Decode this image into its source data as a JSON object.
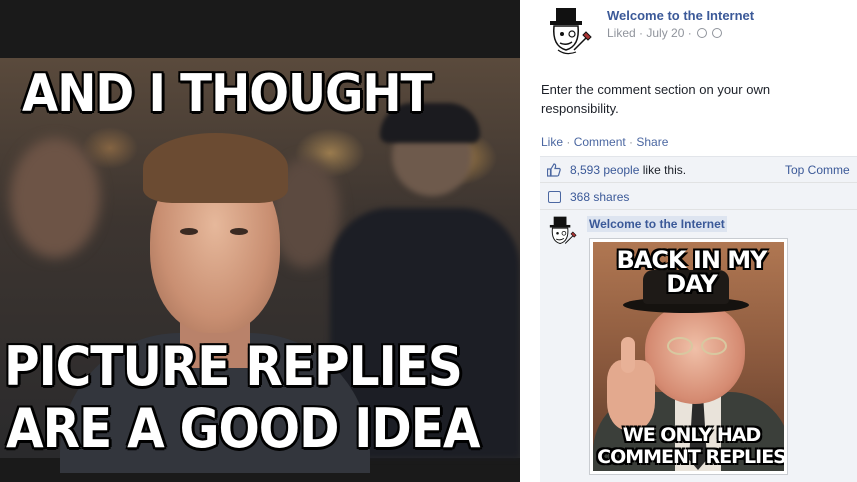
{
  "meme": {
    "caption_top": "AND I THOUGHT",
    "caption_bottom_line1": "PICTURE REPLIES",
    "caption_bottom_line2": "ARE A GOOD IDEA"
  },
  "post": {
    "page_name": "Welcome to the Internet",
    "liked_label": "Liked",
    "date": "July 20",
    "text": "Enter the comment section on your own responsibility.",
    "actions": {
      "like": "Like",
      "comment": "Comment",
      "share": "Share"
    },
    "likes_count": "8,593 people",
    "likes_suffix": " like this.",
    "top_comments_label": "Top Comme",
    "shares_label": "368 shares"
  },
  "comment": {
    "author": "Welcome to the Internet",
    "image_caption_top": "BACK IN MY DAY",
    "image_caption_bottom_line1": "WE ONLY HAD",
    "image_caption_bottom_line2": "COMMENT REPLIES"
  },
  "icons": {
    "avatar": "gentleman-top-hat-icon",
    "like": "thumbs-up-icon",
    "share": "share-icon",
    "privacy": "globe-icon",
    "edit": "clock-icon"
  },
  "colors": {
    "link_blue": "#3b5998",
    "action_blue": "#4b67a1",
    "meta_gray": "#90949c",
    "feedback_bg": "#f1f3f7"
  }
}
